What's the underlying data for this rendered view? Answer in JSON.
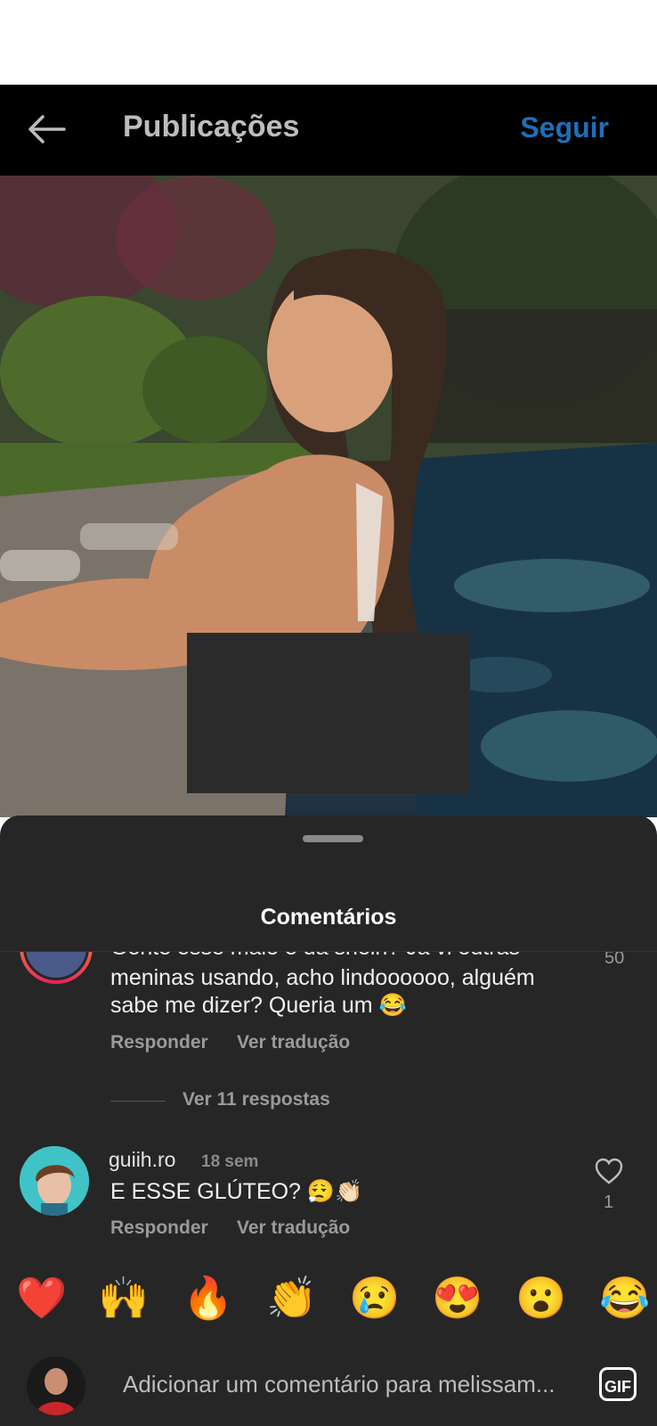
{
  "header": {
    "title": "Publicações",
    "follow_label": "Seguir"
  },
  "sheet": {
    "title": "Comentários"
  },
  "comments": [
    {
      "text_line1": "Gente esse maiô é da shein? Já vi outras",
      "text_line2": "meninas usando, acho lindoooooo, alguém",
      "text_line3": "sabe me dizer? Queria um 😂",
      "like_count": "50",
      "reply_label": "Responder",
      "translate_label": "Ver tradução",
      "view_replies_label": "Ver 11 respostas"
    },
    {
      "username": "guiih.ro",
      "time": "18 sem",
      "text": "E ESSE GLÚTEO? 😮‍💨👏🏻",
      "like_count": "1",
      "reply_label": "Responder",
      "translate_label": "Ver tradução"
    }
  ],
  "emoji_bar": {
    "emojis": [
      "❤️",
      "🙌",
      "🔥",
      "👏",
      "😢",
      "😍",
      "😮",
      "😂"
    ]
  },
  "input": {
    "placeholder": "Adicionar um comentário para melissam...",
    "gif_label": "GIF"
  }
}
